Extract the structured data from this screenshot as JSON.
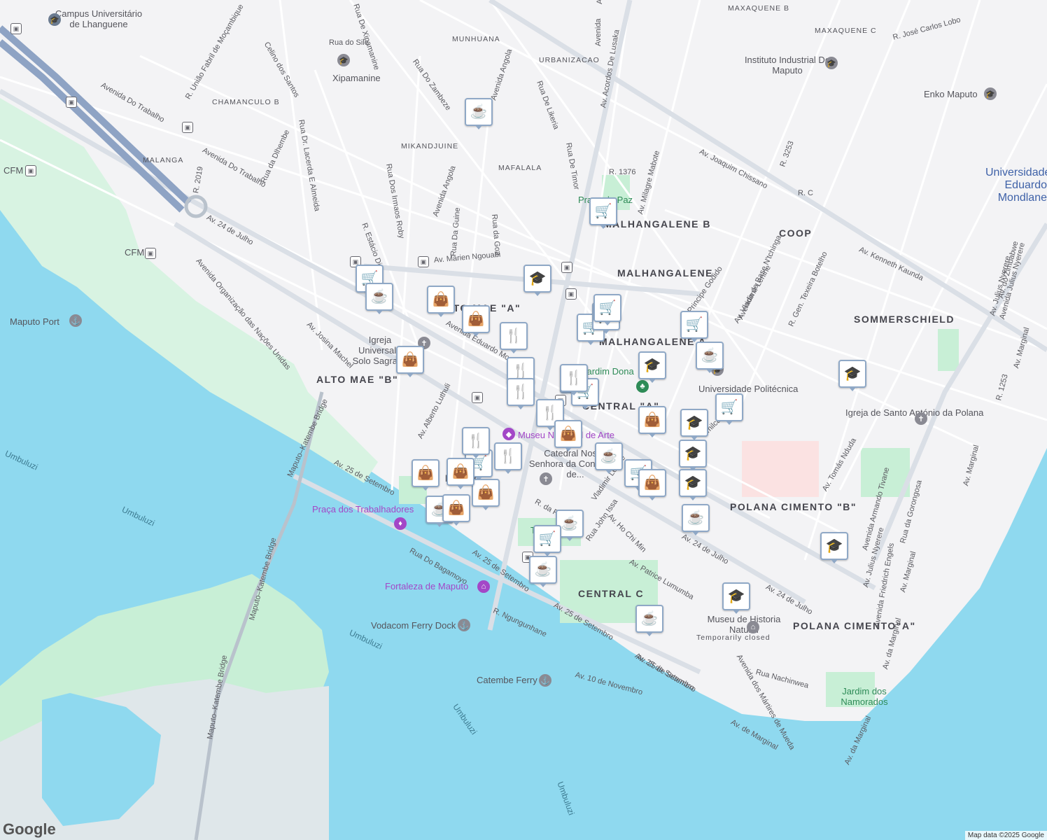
{
  "attribution": "Map data ©2025 Google",
  "logo": "Google",
  "colors": {
    "water": "#8fd9ef",
    "land": "#f3f3f5",
    "park": "#c8efd6",
    "road": "#ffffff",
    "major_road": "#dadfe6",
    "highway": "#8ea3c4",
    "pin_icon": "#0d3559",
    "pin_border": "#8fa8c6",
    "green_poi": "#2e8b57",
    "purple_poi": "#a347c7"
  },
  "districts": [
    {
      "text": "ALTO MAE \"B\""
    },
    {
      "text": "ALTO MAE \"A\""
    },
    {
      "text": "MALHANGALENE B"
    },
    {
      "text": "MALHANGALENE"
    },
    {
      "text": "MALHANGALENE A"
    },
    {
      "text": "CENTRAL \"A\""
    },
    {
      "text": "CENTRAL C"
    },
    {
      "text": "SOMMERSCHIELD"
    },
    {
      "text": "COOP"
    },
    {
      "text": "POLANA CIMENTO \"B\""
    },
    {
      "text": "POLANA CIMENTO\"A\""
    },
    {
      "text": "BAIXA"
    }
  ],
  "small_districts": [
    "MAXAQUENE B",
    "MAXAQUENE C",
    "MUNHUANA",
    "URBANIZACAO",
    "CHAMANCULO B",
    "MIKANDJUINE",
    "MAFALALA",
    "MALANGA"
  ],
  "places": {
    "campus": "Campus Universitário de Lhanguene",
    "xipamanine": "Xipamanine",
    "instituto": "Instituto Industrial De Maputo",
    "enko": "Enko Maputo",
    "uem": "Universidade Eduardo Mondlane",
    "cfm1": "CFM",
    "cfm2": "CFM",
    "port": "Maputo Port",
    "igreja": "Igreja Universal - Solo Sagrado",
    "jardim_dona": "Jardim Dona",
    "politecnica": "Universidade Politécnica",
    "igreja_polana": "Igreja de Santo António da Polana",
    "museu_arte": "Museu Nacional de Arte",
    "catedral": "Catedral Nossa Senhora da Conceição de...",
    "praca_trab": "Praça dos Trabalhadores",
    "fortaleza": "Fortaleza de Maputo",
    "vodacom": "Vodacom Ferry Dock",
    "catembe": "Catembe Ferry",
    "museu_hist": "Museu de Historia Natural",
    "temp_closed": "Temporarily closed",
    "jardim_nam": "Jardim dos Namorados",
    "praca_paz": "Praça da Paz",
    "tunduru": "Tunduru"
  },
  "water_labels": [
    "Umbuluzi",
    "Umbuluzi",
    "Umbuluzi",
    "Umbuluzi",
    "Umbuluzi"
  ],
  "streets": [
    "Avenida Do Trabalho",
    "Avenida Do Trabalho",
    "Av. 24 de Julho",
    "Avenida Organização das Nações Unidas",
    "Av. Josina Machel",
    "Maputo–Katembe Bridge",
    "Maputo–Katembe Bridge",
    "Maputo–Katembe Bridge",
    "Av. 25 de Setembro",
    "Av. 25 de Setembro",
    "Av. 25 de Setembro",
    "Av. 25 de Setembro",
    "Av. 25 de Setembro",
    "Rua Do Bagamoyo",
    "R. Ngungunhane",
    "Av. 10 de Novembro",
    "Av. Marien Ngouabi",
    "Avenida Eduardo Mondlane",
    "Av. Alberto Luthuli",
    "Avenida Angola",
    "Avenida Angola",
    "Rua Dos Irmaos Roby",
    "Rua De Xipamanine",
    "Rua Dr. Lacerda E Almeida",
    "R. Estácio Dias",
    "Rua Da Guine",
    "Rua da Goa",
    "Rua De Likeria",
    "Rua Do Zambeze",
    "Rua De Timor",
    "Av. Acordos De Lusaka",
    "Avenida Do Trabalho",
    "Av. Milagre Mabote",
    "Av. Joaquim Chissano",
    "R. 1376",
    "R. União Fabril de Moçambique",
    "Rua da Dlhembe",
    "R. 2019",
    "Av. Vladimir Lenine",
    "R. José Carlos Lobo",
    "R. 3253",
    "R. C",
    "Av. Kenneth Kaunda",
    "R. Gen. Texeira Botelho",
    "Avenida da Base N'tchinga",
    "Principe Godido",
    "Av. Julius Nyerere",
    "Avenida Julius Nyerere",
    "Av. do Zimbabwe",
    "Av. Marginal",
    "R. 1253",
    "Av. Marginal",
    "Av. Tomás Nduda",
    "Avenida Armando Tivane",
    "Av. Julius Nyerere",
    "Rua da Gorongosa",
    "Avenida Friedrich Engels",
    "Av. Marginal",
    "Av. da Marginal",
    "Av. da Marginal",
    "Av. 24 de Julho",
    "Av. 24 de Julho",
    "Av. Patrice Lumumba",
    "Av. Ho Chi Min",
    "Rua John Issa",
    "Vladimir Lenine",
    "R. da R",
    "Rua Nachinwea",
    "Avenida dos Mártires de Mueda",
    "Av. de Marginal",
    "Rua do Sile",
    "Celino dos Santos",
    "Avenida",
    "Amilcar Ca"
  ],
  "pins": [
    {
      "icon": "cafe"
    },
    {
      "icon": "cart"
    },
    {
      "icon": "school"
    },
    {
      "icon": "cart"
    },
    {
      "icon": "cafe"
    },
    {
      "icon": "shopping"
    },
    {
      "icon": "shopping"
    },
    {
      "icon": "restaurant"
    },
    {
      "icon": "shopping"
    },
    {
      "icon": "restaurant"
    },
    {
      "icon": "restaurant"
    },
    {
      "icon": "restaurant"
    },
    {
      "icon": "restaurant"
    },
    {
      "icon": "cart"
    },
    {
      "icon": "cart"
    },
    {
      "icon": "cart"
    },
    {
      "icon": "cart"
    },
    {
      "icon": "school"
    },
    {
      "icon": "cafe"
    },
    {
      "icon": "cart"
    },
    {
      "icon": "school"
    },
    {
      "icon": "school"
    },
    {
      "icon": "cart"
    },
    {
      "icon": "shopping"
    },
    {
      "icon": "shopping"
    },
    {
      "icon": "school"
    },
    {
      "icon": "school"
    },
    {
      "icon": "cafe"
    },
    {
      "icon": "school"
    },
    {
      "icon": "cart"
    },
    {
      "icon": "shopping"
    },
    {
      "icon": "cafe"
    },
    {
      "icon": "restaurant"
    },
    {
      "icon": "restaurant"
    },
    {
      "icon": "cart"
    },
    {
      "icon": "shopping"
    },
    {
      "icon": "shopping"
    },
    {
      "icon": "shopping"
    },
    {
      "icon": "cafe"
    },
    {
      "icon": "shopping"
    },
    {
      "icon": "cafe"
    },
    {
      "icon": "cart"
    },
    {
      "icon": "cafe"
    },
    {
      "icon": "school"
    },
    {
      "icon": "cafe"
    },
    {
      "icon": "restaurant"
    }
  ]
}
